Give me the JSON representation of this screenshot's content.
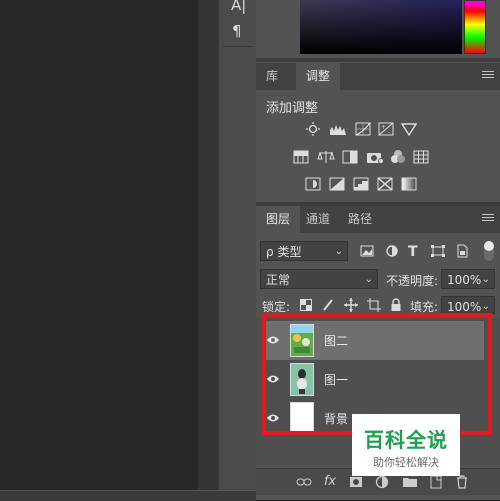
{
  "toolstrip": {
    "text_tool_glyph": "A|",
    "paragraph_glyph": "¶"
  },
  "adjust_panel": {
    "tabs": [
      {
        "label": "库"
      },
      {
        "label": "调整"
      }
    ],
    "heading": "添加调整"
  },
  "layers_panel": {
    "tabs": [
      {
        "label": "图层"
      },
      {
        "label": "通道"
      },
      {
        "label": "路径"
      }
    ],
    "filter": {
      "kind": "类型",
      "search_glyph": "ρ"
    },
    "blend_mode": "正常",
    "opacity_label": "不透明度:",
    "opacity_value": "100%",
    "lock_label": "锁定:",
    "fill_label": "填充:",
    "fill_value": "100%",
    "layers": [
      {
        "name": "图二",
        "selected": true
      },
      {
        "name": "图一",
        "selected": false
      },
      {
        "name": "背景",
        "selected": false
      }
    ],
    "footer_fx": "fx"
  },
  "watermark": {
    "title": "百科全说",
    "subtitle": "助你轻松解决"
  },
  "colors": {
    "highlight": "#e21a1a",
    "watermark_green": "#1aa24a"
  }
}
